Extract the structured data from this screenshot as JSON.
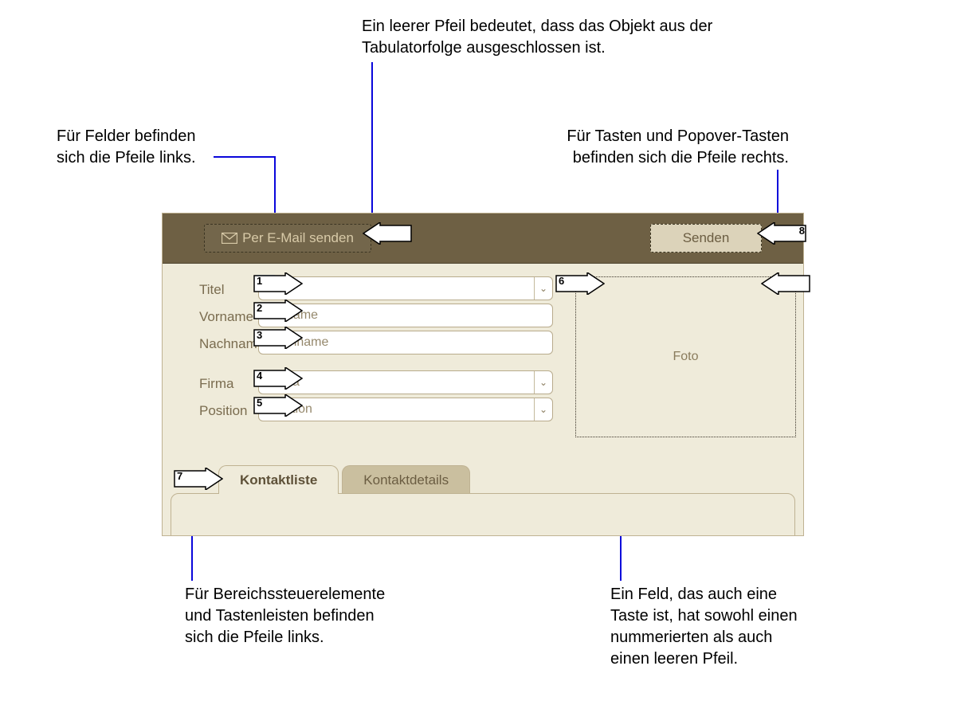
{
  "annotations": {
    "empty_arrow": "Ein leerer Pfeil bedeutet, dass das Objekt aus der Tabulatorfolge ausgeschlossen ist.",
    "fields_left_1": "Für Felder befinden",
    "fields_left_2": "sich die Pfeile links.",
    "buttons_right_1": "Für Tasten und Popover-Tasten",
    "buttons_right_2": "befinden sich die Pfeile rechts.",
    "tab_controls_1": "Für Bereichssteuerelemente",
    "tab_controls_2": "und Tastenleisten befinden",
    "tab_controls_3": "sich die Pfeile links.",
    "field_button_1": "Ein Feld, das auch eine",
    "field_button_2": "Taste ist, hat sowohl einen",
    "field_button_3": "nummerierten als auch",
    "field_button_4": "einen leeren Pfeil."
  },
  "topbar": {
    "send_email": "Per E-Mail senden",
    "send": "Senden"
  },
  "fields": {
    "titel": {
      "label": "Titel",
      "placeholder": "Titel"
    },
    "vorname": {
      "label": "Vorname",
      "placeholder": "Vorname"
    },
    "nachname": {
      "label": "Nachname",
      "placeholder": "Nachname"
    },
    "firma": {
      "label": "Firma",
      "placeholder": "Firma"
    },
    "position": {
      "label": "Position",
      "placeholder": "Position"
    }
  },
  "photo_label": "Foto",
  "tabs": {
    "active": "Kontaktliste",
    "inactive": "Kontaktdetails"
  },
  "tab_order": {
    "n1": "1",
    "n2": "2",
    "n3": "3",
    "n4": "4",
    "n5": "5",
    "n6": "6",
    "n7": "7",
    "n8": "8"
  }
}
